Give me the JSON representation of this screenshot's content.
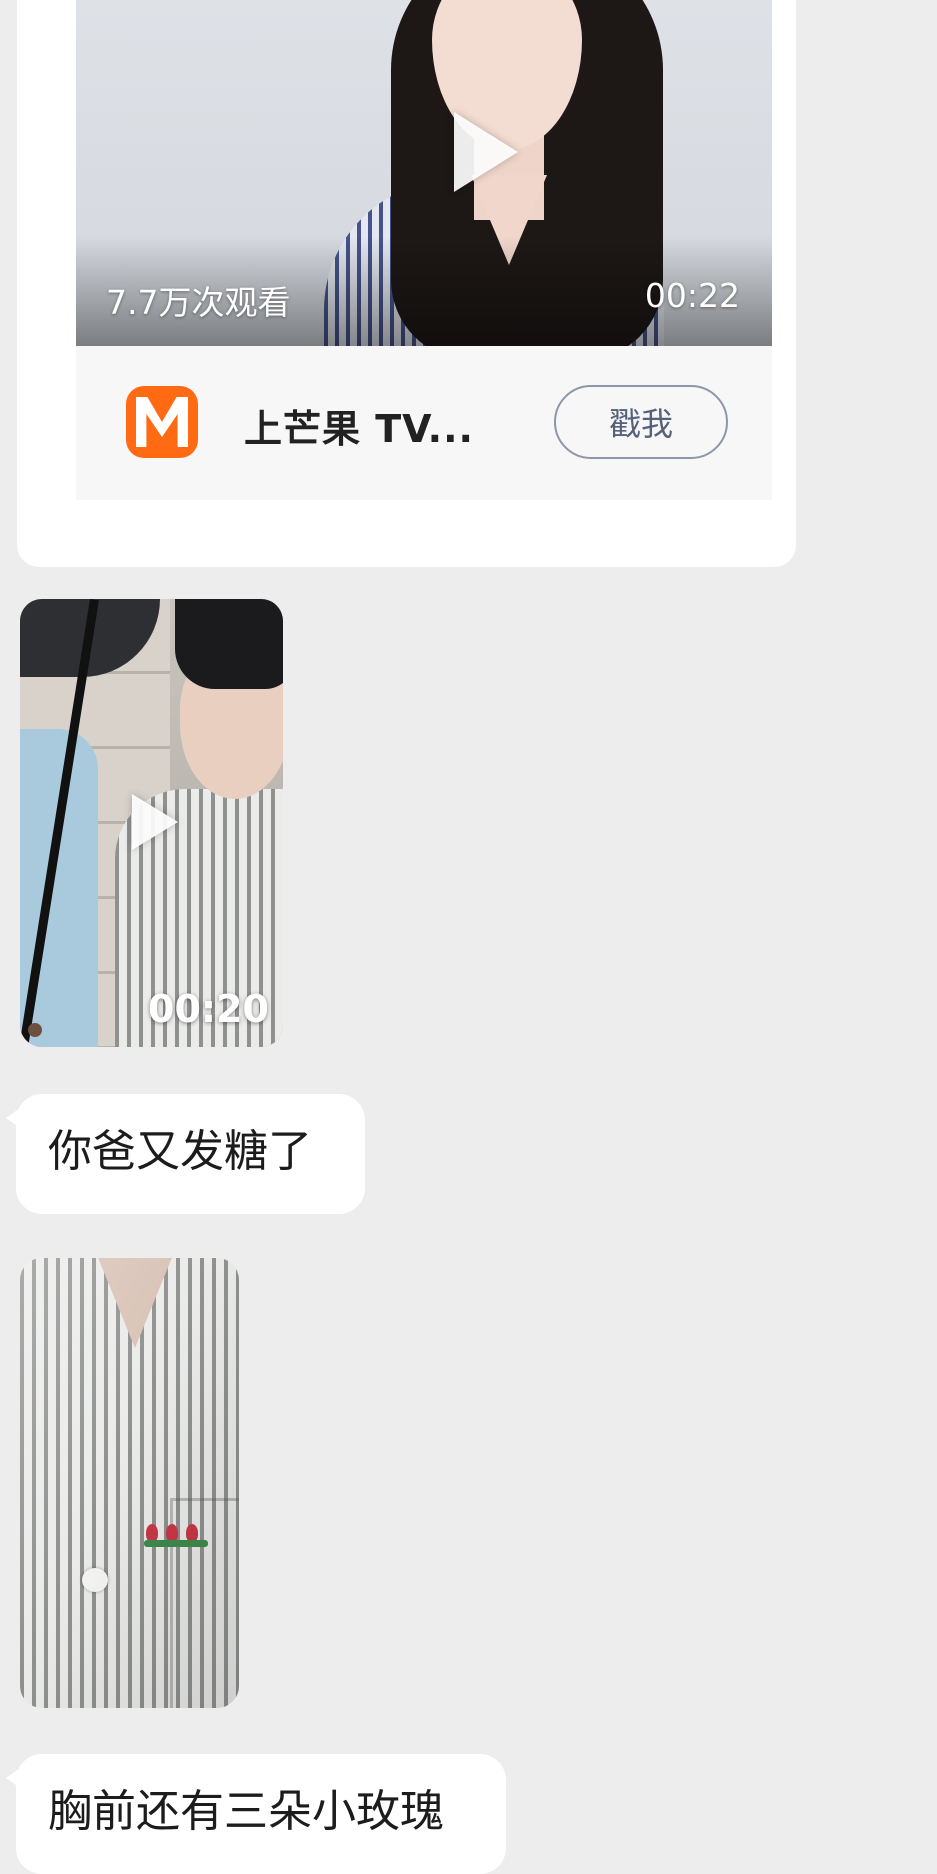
{
  "share_card": {
    "view_count": "7.7万次观看",
    "duration": "00:22",
    "source_name": "上芒果 TV...",
    "poke_label": "戳我"
  },
  "video_message": {
    "duration": "00:20"
  },
  "messages": [
    {
      "text": "你爸又发糖了"
    },
    {
      "text": "胸前还有三朵小玫瑰"
    }
  ],
  "colors": {
    "background": "#ededed",
    "bubble": "#ffffff",
    "mgtv_brand": "#ff6a13"
  },
  "icons": {
    "play": "play-icon",
    "logo": "mgtv-logo"
  }
}
